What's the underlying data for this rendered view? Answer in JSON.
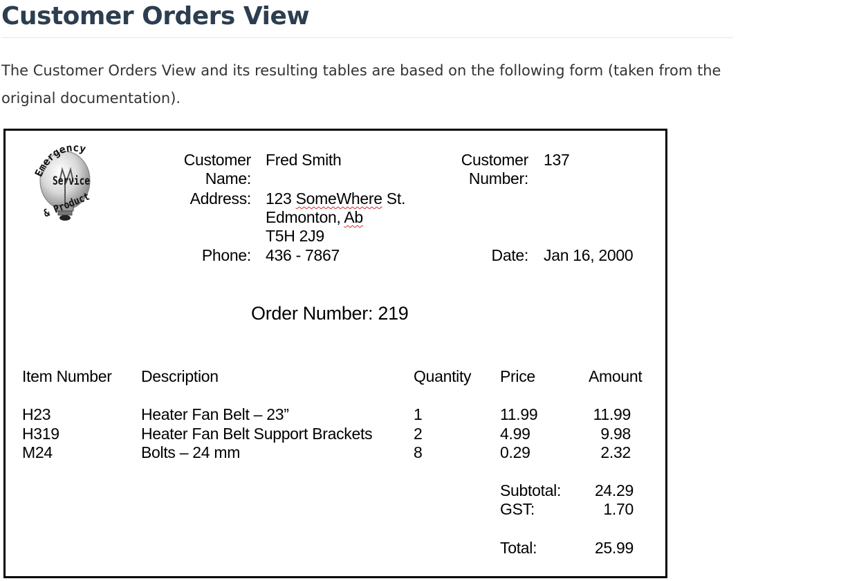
{
  "page": {
    "title": "Customer Orders View",
    "intro": "The Customer Orders View and its resulting tables are based on the following form (taken from the original documentation)."
  },
  "form": {
    "logo": {
      "icon": "emergency-service-product-lightbulb-icon",
      "lines": [
        "Emergency",
        "Service",
        "& Product"
      ]
    },
    "customer": {
      "name_label_line1": "Customer",
      "name_label_line2": "Name:",
      "name": "Fred Smith",
      "address_label": "Address:",
      "address_street_part1": "123 ",
      "address_street_word": "SomeWhere",
      "address_street_part2": " St.",
      "address_city": "Edmonton, ",
      "address_province": "Ab",
      "address_postal": "T5H 2J9",
      "phone_label": "Phone:",
      "phone": "436 - 7867",
      "number_label_line1": "Customer",
      "number_label_line2": "Number:",
      "number": "137",
      "date_label": "Date:",
      "date": "Jan 16, 2000"
    },
    "order_number": "Order Number: 219",
    "table": {
      "headers": {
        "item": "Item Number",
        "description": "Description",
        "quantity": "Quantity",
        "price": "Price",
        "amount": "Amount"
      },
      "rows": [
        {
          "item": "H23",
          "description": "Heater Fan Belt – 23”",
          "quantity": "1",
          "price": "11.99",
          "amount": "11.99"
        },
        {
          "item": "H319",
          "description": "Heater Fan Belt Support Brackets",
          "quantity": "2",
          "price": "4.99",
          "amount": "9.98"
        },
        {
          "item": "M24",
          "description": "Bolts – 24 mm",
          "quantity": "8",
          "price": "0.29",
          "amount": "2.32"
        }
      ]
    },
    "totals": {
      "subtotal_label": "Subtotal:",
      "subtotal": "24.29",
      "gst_label": "GST:",
      "gst": "1.70",
      "total_label": "Total:",
      "total": "25.99"
    }
  }
}
